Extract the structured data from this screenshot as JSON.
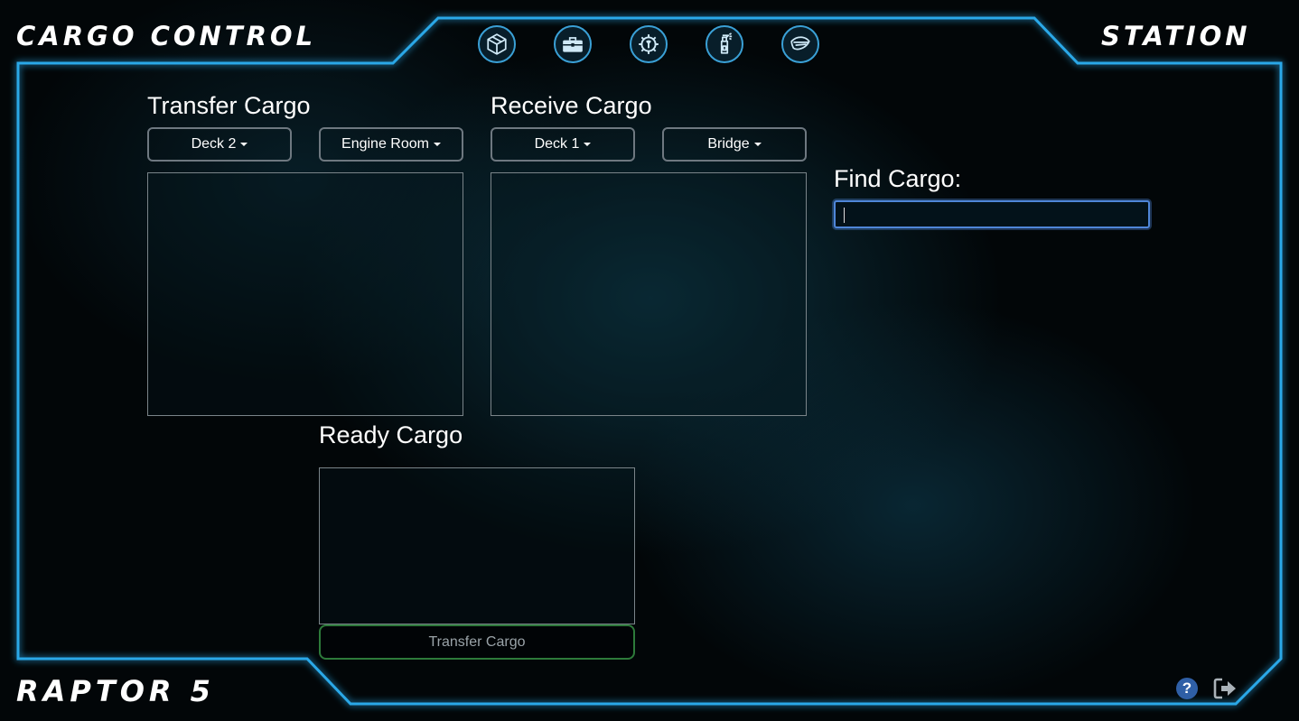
{
  "header": {
    "app_title": "CARGO CONTROL",
    "mode": "STATION",
    "ship_name": "RAPTOR 5"
  },
  "nav": {
    "icons": [
      "package-icon",
      "toolbox-icon",
      "gear-wrench-icon",
      "spray-bottle-icon",
      "leaf-icon"
    ]
  },
  "transfer": {
    "heading": "Transfer Cargo",
    "deck": "Deck 2",
    "room": "Engine Room"
  },
  "receive": {
    "heading": "Receive Cargo",
    "deck": "Deck 1",
    "room": "Bridge"
  },
  "ready": {
    "heading": "Ready Cargo",
    "button_label": "Transfer Cargo"
  },
  "search": {
    "label": "Find Cargo:",
    "value": ""
  },
  "footer": {
    "help_glyph": "?"
  },
  "colors": {
    "frame_glow": "#2aa8e8",
    "input_focus": "#4f86d8",
    "button_border": "#2d7a3a"
  }
}
